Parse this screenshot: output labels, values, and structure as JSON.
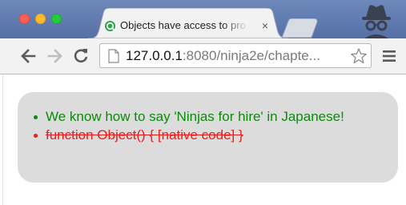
{
  "window": {
    "tab": {
      "title": "Objects have access to pro",
      "close_glyph": "×",
      "favicon": "page-favicon-icon"
    },
    "incognito_icon": "incognito-icon"
  },
  "toolbar": {
    "url_host": "127.0.0.1",
    "url_rest": ":8080/ninja2e/chapte...",
    "back_icon": "back-arrow-icon",
    "forward_icon": "forward-arrow-icon",
    "reload_icon": "reload-icon",
    "bookmark_icon": "star-icon",
    "menu_icon": "menu-icon"
  },
  "page": {
    "results": [
      {
        "status": "pass",
        "text": "We know how to say 'Ninjas for hire' in Japanese!"
      },
      {
        "status": "fail",
        "text": "function Object() { [native code] }"
      }
    ]
  },
  "colors": {
    "pass": "#0d8a0d",
    "fail": "#ee1b1b",
    "panel": "#dcdcdc",
    "tabstrip": "#5b76ab"
  }
}
